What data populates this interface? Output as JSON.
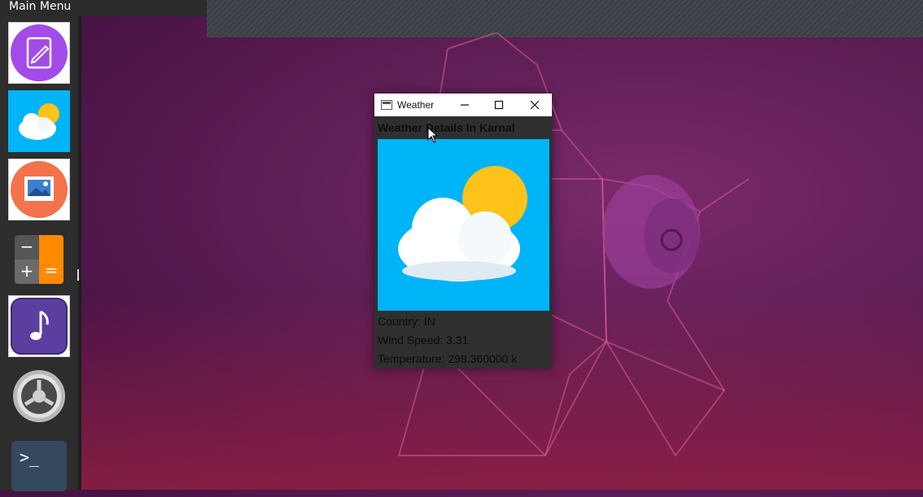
{
  "desktop": {
    "main_menu_label": "Main Menu",
    "dock_items": [
      {
        "name": "Text Editor",
        "icon": "text-editor-icon"
      },
      {
        "name": "Weather",
        "icon": "weather-icon"
      },
      {
        "name": "Image Viewer",
        "icon": "image-viewer-icon"
      },
      {
        "name": "Calculator",
        "icon": "calculator-icon"
      },
      {
        "name": "Music",
        "icon": "music-icon"
      },
      {
        "name": "Settings",
        "icon": "settings-icon"
      },
      {
        "name": "Terminal",
        "icon": "terminal-icon"
      }
    ],
    "calculator_glyphs": {
      "minus": "−",
      "plus": "+",
      "equals": "="
    },
    "terminal_glyph": ">_"
  },
  "weather_window": {
    "title": "Weather",
    "heading": "Weather Details In Karnal",
    "country": "Country: IN",
    "wind_speed": "Wind Speed: 3.31",
    "temperature": "Temperature: 298.360000 k",
    "image_icon": "partly-cloudy-icon"
  },
  "colors": {
    "weather_sky": "#00b4f8",
    "sun": "#ffc21a",
    "accent_orange": "#ff8a00",
    "music_purple": "#5b3fa0"
  }
}
